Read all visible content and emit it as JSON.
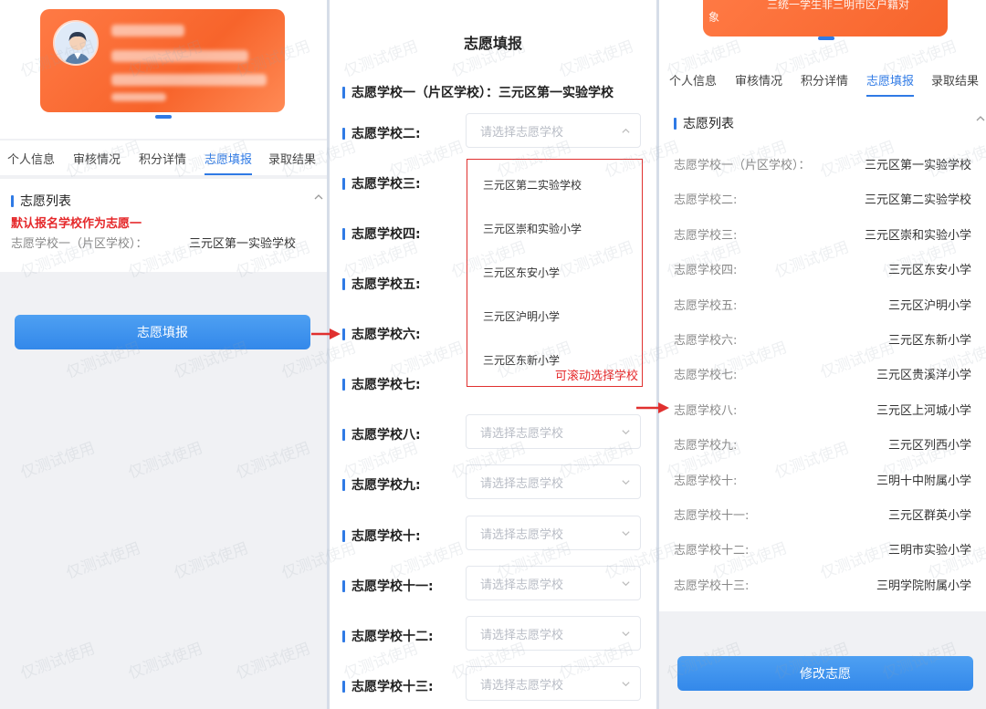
{
  "panel1": {
    "tabs": [
      "个人信息",
      "审核情况",
      "积分详情",
      "志愿填报",
      "录取结果"
    ],
    "section_title": "志愿列表",
    "red_note": "默认报名学校作为志愿一",
    "row_label": "志愿学校一（片区学校）：",
    "row_value": "三元区第一实验学校",
    "button_label": "志愿填报"
  },
  "panel2": {
    "title": "志愿填报",
    "first_line": "志愿学校一（片区学校）：三元区第一实验学校",
    "select_placeholder": "请选择志愿学校",
    "fields": [
      "志愿学校二:",
      "志愿学校三:",
      "志愿学校四:",
      "志愿学校五:",
      "志愿学校六:",
      "志愿学校七:",
      "志愿学校八:",
      "志愿学校九:",
      "志愿学校十:",
      "志愿学校十一:",
      "志愿学校十二:",
      "志愿学校十三:"
    ],
    "dropdown_options": [
      "三元区第二实验学校",
      "三元区崇和实验小学",
      "三元区东安小学",
      "三元区沪明小学",
      "三元区东新小学"
    ],
    "dropdown_note": "可滚动选择学校"
  },
  "panel3": {
    "card_text_line1": "三统一学生非三明市区户籍对",
    "card_text_line2": "象",
    "tabs": [
      "个人信息",
      "审核情况",
      "积分详情",
      "志愿填报",
      "录取结果"
    ],
    "section_title": "志愿列表",
    "rows": [
      {
        "label": "志愿学校一（片区学校）：",
        "value": "三元区第一实验学校"
      },
      {
        "label": "志愿学校二:",
        "value": "三元区第二实验学校"
      },
      {
        "label": "志愿学校三:",
        "value": "三元区崇和实验小学"
      },
      {
        "label": "志愿学校四:",
        "value": "三元区东安小学"
      },
      {
        "label": "志愿学校五:",
        "value": "三元区沪明小学"
      },
      {
        "label": "志愿学校六:",
        "value": "三元区东新小学"
      },
      {
        "label": "志愿学校七:",
        "value": "三元区贵溪洋小学"
      },
      {
        "label": "志愿学校八:",
        "value": "三元区上河城小学"
      },
      {
        "label": "志愿学校九:",
        "value": "三元区列西小学"
      },
      {
        "label": "志愿学校十:",
        "value": "三明十中附属小学"
      },
      {
        "label": "志愿学校十一:",
        "value": "三元区群英小学"
      },
      {
        "label": "志愿学校十二:",
        "value": "三明市实验小学"
      },
      {
        "label": "志愿学校十三:",
        "value": "三明学院附属小学"
      }
    ],
    "button_label": "修改志愿"
  },
  "watermark": "仅测试使用",
  "colors": {
    "primary": "#2f7ae5",
    "accent_orange": "#f7642b",
    "annotation_red": "#e5282a"
  }
}
